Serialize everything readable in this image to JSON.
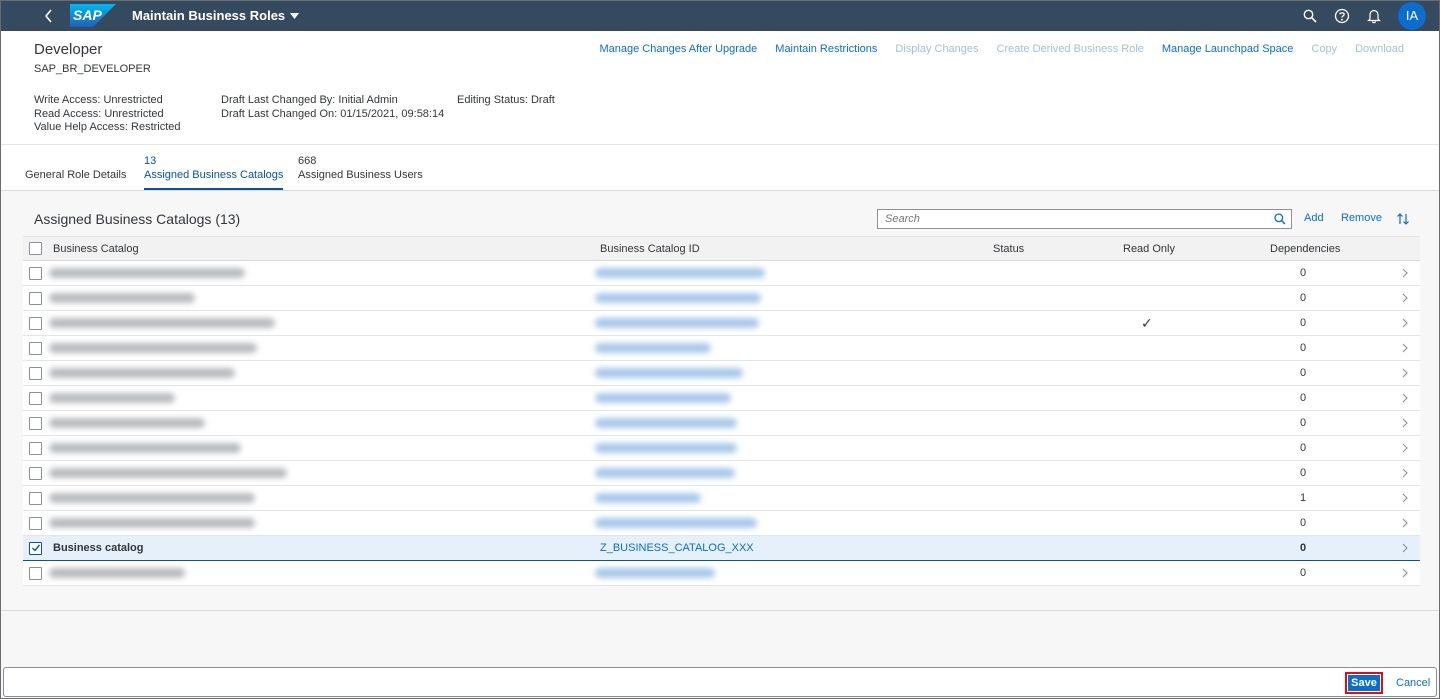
{
  "shell": {
    "logo_text": "SAP",
    "app_title": "Maintain Business Roles",
    "user_initials": "IA",
    "colors": {
      "shell_bg": "#354a5f",
      "accent": "#0a6ed1"
    }
  },
  "header": {
    "title": "Developer",
    "subtitle": "SAP_BR_DEVELOPER",
    "attributes": {
      "write_access": "Write Access: Unrestricted",
      "read_access": "Read Access: Unrestricted",
      "value_help_access": "Value Help Access: Restricted",
      "draft_changed_by": "Draft Last Changed By: Initial Admin",
      "draft_changed_on": "Draft Last Changed On: 01/15/2021, 09:58:14",
      "editing_status": "Editing Status: Draft"
    },
    "actions": {
      "manage_changes": "Manage Changes After Upgrade",
      "maintain_restrictions": "Maintain Restrictions",
      "display_changes": "Display Changes",
      "create_derived": "Create Derived Business Role",
      "manage_launchpad": "Manage Launchpad Space",
      "copy": "Copy",
      "download": "Download"
    }
  },
  "tabs": {
    "general": {
      "label": "General Role Details"
    },
    "catalogs": {
      "count": "13",
      "label": "Assigned Business Catalogs"
    },
    "users": {
      "count": "668",
      "label": "Assigned Business Users"
    }
  },
  "section": {
    "title": "Assigned Business Catalogs (13)",
    "search_placeholder": "Search",
    "add_label": "Add",
    "remove_label": "Remove"
  },
  "table": {
    "headers": {
      "catalog": "Business Catalog",
      "catalog_id": "Business Catalog ID",
      "status": "Status",
      "read_only": "Read Only",
      "dependencies": "Dependencies"
    },
    "rows": [
      {
        "dependencies": "0"
      },
      {
        "dependencies": "0"
      },
      {
        "dependencies": "0",
        "read_only_mark": "✓"
      },
      {
        "dependencies": "0"
      },
      {
        "dependencies": "0"
      },
      {
        "dependencies": "0"
      },
      {
        "dependencies": "0"
      },
      {
        "dependencies": "0"
      },
      {
        "dependencies": "0"
      },
      {
        "dependencies": "1"
      },
      {
        "dependencies": "0"
      },
      {
        "name": "Business catalog",
        "id": "Z_BUSINESS_CATALOG_XXX",
        "dependencies": "0",
        "selected": true
      },
      {
        "dependencies": "0"
      }
    ]
  },
  "footer": {
    "save_label": "Save",
    "cancel_label": "Cancel"
  }
}
